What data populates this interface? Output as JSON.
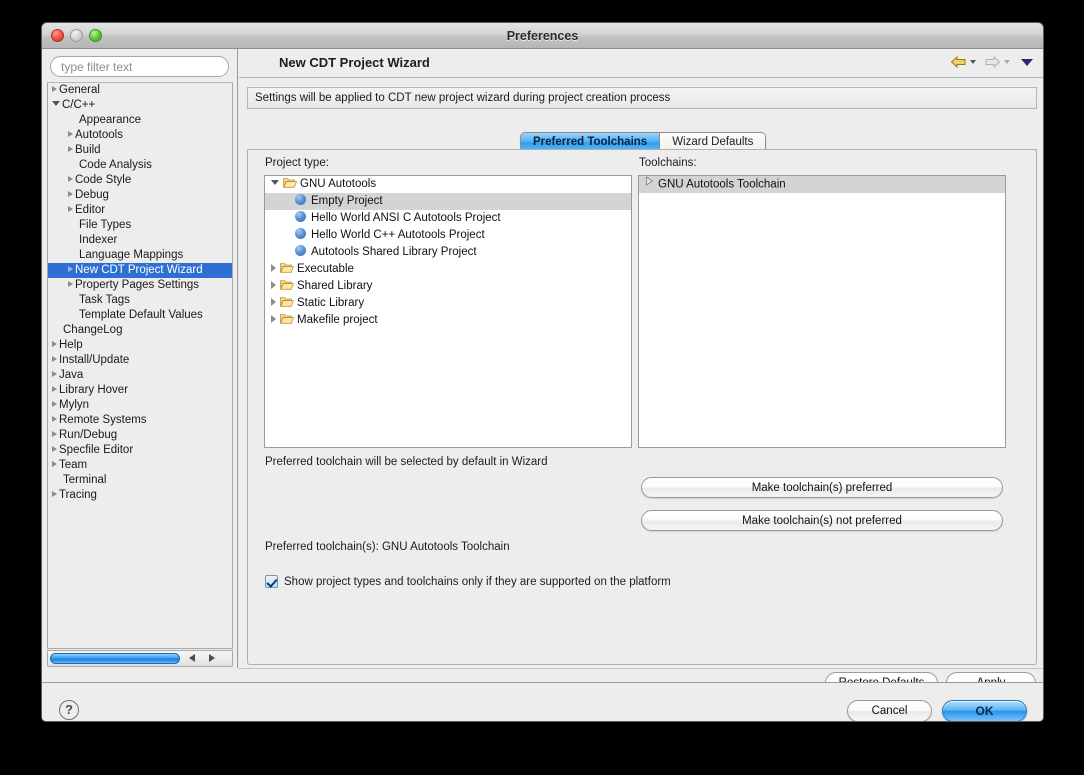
{
  "window": {
    "title": "Preferences",
    "traffic_lights": [
      "close-red",
      "minimize-yellow",
      "zoom-green"
    ]
  },
  "sidebar": {
    "filter_placeholder": "type filter text",
    "filter_value": "",
    "selected": "New CDT Project Wizard",
    "items": [
      {
        "label": "General",
        "indent": 0,
        "arrow": "closed"
      },
      {
        "label": "C/C++",
        "indent": 0,
        "arrow": "open"
      },
      {
        "label": "Appearance",
        "indent": 1,
        "arrow": "none"
      },
      {
        "label": "Autotools",
        "indent": 1,
        "arrow": "closed"
      },
      {
        "label": "Build",
        "indent": 1,
        "arrow": "closed"
      },
      {
        "label": "Code Analysis",
        "indent": 1,
        "arrow": "none"
      },
      {
        "label": "Code Style",
        "indent": 1,
        "arrow": "closed"
      },
      {
        "label": "Debug",
        "indent": 1,
        "arrow": "closed"
      },
      {
        "label": "Editor",
        "indent": 1,
        "arrow": "closed"
      },
      {
        "label": "File Types",
        "indent": 1,
        "arrow": "none"
      },
      {
        "label": "Indexer",
        "indent": 1,
        "arrow": "none"
      },
      {
        "label": "Language Mappings",
        "indent": 1,
        "arrow": "none"
      },
      {
        "label": "New CDT Project Wizard",
        "indent": 1,
        "arrow": "closed",
        "selected": true
      },
      {
        "label": "Property Pages Settings",
        "indent": 1,
        "arrow": "closed"
      },
      {
        "label": "Task Tags",
        "indent": 1,
        "arrow": "none"
      },
      {
        "label": "Template Default Values",
        "indent": 1,
        "arrow": "none"
      },
      {
        "label": "ChangeLog",
        "indent": 0,
        "arrow": "none"
      },
      {
        "label": "Help",
        "indent": 0,
        "arrow": "closed"
      },
      {
        "label": "Install/Update",
        "indent": 0,
        "arrow": "closed"
      },
      {
        "label": "Java",
        "indent": 0,
        "arrow": "closed"
      },
      {
        "label": "Library Hover",
        "indent": 0,
        "arrow": "closed"
      },
      {
        "label": "Mylyn",
        "indent": 0,
        "arrow": "closed"
      },
      {
        "label": "Remote Systems",
        "indent": 0,
        "arrow": "closed"
      },
      {
        "label": "Run/Debug",
        "indent": 0,
        "arrow": "closed"
      },
      {
        "label": "Specfile Editor",
        "indent": 0,
        "arrow": "closed"
      },
      {
        "label": "Team",
        "indent": 0,
        "arrow": "closed"
      },
      {
        "label": "Terminal",
        "indent": 0,
        "arrow": "none"
      },
      {
        "label": "Tracing",
        "indent": 0,
        "arrow": "closed"
      }
    ],
    "scrollbar": {
      "left_arrow": "scroll-left-icon",
      "right_arrow": "scroll-right-icon"
    }
  },
  "main": {
    "title": "New CDT Project Wizard",
    "nav": {
      "back_icon": "back-arrow-icon",
      "forward_icon": "forward-arrow-icon",
      "menu_icon": "view-menu-icon"
    },
    "message": "Settings will be applied to CDT new project wizard during project creation process",
    "tabs": [
      {
        "label": "Preferred Toolchains",
        "active": true
      },
      {
        "label": "Wizard Defaults",
        "active": false
      }
    ],
    "project_type_label": "Project type:",
    "project_types": [
      {
        "label": "GNU Autotools",
        "indent": 0,
        "icon": "folder-open-icon",
        "arrow": "open"
      },
      {
        "label": "Empty Project",
        "indent": 1,
        "icon": "sphere-icon",
        "arrow": "none",
        "selected": true
      },
      {
        "label": "Hello World ANSI C Autotools Project",
        "indent": 1,
        "icon": "sphere-icon",
        "arrow": "none"
      },
      {
        "label": "Hello World C++ Autotools Project",
        "indent": 1,
        "icon": "sphere-icon",
        "arrow": "none"
      },
      {
        "label": "Autotools Shared Library Project",
        "indent": 1,
        "icon": "sphere-icon",
        "arrow": "none"
      },
      {
        "label": "Executable",
        "indent": 0,
        "icon": "folder-open-icon",
        "arrow": "closed"
      },
      {
        "label": "Shared Library",
        "indent": 0,
        "icon": "folder-open-icon",
        "arrow": "closed"
      },
      {
        "label": "Static Library",
        "indent": 0,
        "icon": "folder-open-icon",
        "arrow": "closed"
      },
      {
        "label": "Makefile project",
        "indent": 0,
        "icon": "folder-open-icon",
        "arrow": "closed"
      }
    ],
    "toolchains_label": "Toolchains:",
    "toolchains": [
      {
        "label": "GNU Autotools Toolchain",
        "arrow": "closed-hollow",
        "selected": true
      }
    ],
    "hint_text": "Preferred toolchain will be selected by default in Wizard",
    "make_preferred_label": "Make toolchain(s) preferred",
    "make_not_preferred_label": "Make toolchain(s) not preferred",
    "preferred_summary": "Preferred toolchain(s): GNU Autotools Toolchain",
    "show_supported_label": "Show project types and toolchains only if they are supported on the platform",
    "show_supported_checked": true,
    "restore_defaults_label": "Restore Defaults",
    "apply_label": "Apply"
  },
  "footer": {
    "help_label": "?",
    "cancel_label": "Cancel",
    "ok_label": "OK"
  },
  "colors": {
    "selection_blue": "#2f6fd4",
    "tab_active_blue": "#2d9cf0",
    "ok_button_blue": "#2a92ec",
    "folder_yellow": "#e8b84b",
    "sphere_blue": "#5a93d4",
    "window_bg": "#ededed",
    "nav_back_gold": "#d8a41e"
  }
}
